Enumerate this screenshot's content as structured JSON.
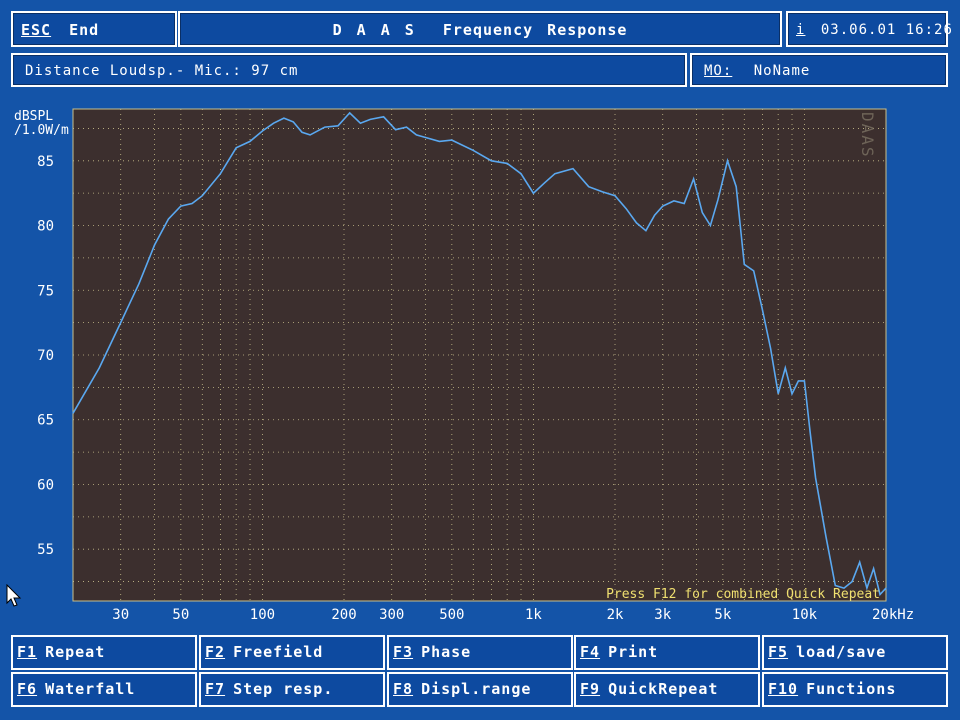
{
  "title_bar": {
    "esc_key": "ESC",
    "esc_label": "End",
    "title": "D A A S  Frequency Response",
    "info_key": "i",
    "datetime": "03.06.01 16:26"
  },
  "info_bar": {
    "distance_label": "Distance Loudsp.- Mic.: 97 cm",
    "mo_key": "MO:",
    "mo_value": "NoName"
  },
  "chart_header": {
    "ylabel_line1": "dBSPL",
    "ylabel_line2": "/1.0W/m",
    "watermark": "DAAS",
    "hint": "Press F12 for combined Quick Repeat",
    "x_unit": "20kHz"
  },
  "function_keys": [
    {
      "key": "F1",
      "label": "Repeat"
    },
    {
      "key": "F2",
      "label": "Freefield"
    },
    {
      "key": "F3",
      "label": "Phase"
    },
    {
      "key": "F4",
      "label": "Print"
    },
    {
      "key": "F5",
      "label": "load/save"
    },
    {
      "key": "F6",
      "label": "Waterfall"
    },
    {
      "key": "F7",
      "label": "Step resp."
    },
    {
      "key": "F8",
      "label": "Displ.range"
    },
    {
      "key": "F9",
      "label": "QuickRepeat"
    },
    {
      "key": "F10",
      "label": "Functions"
    }
  ],
  "colors": {
    "background": "#1454a8",
    "plot_bg": "#3c2f2e",
    "grid": "#c8bf8c",
    "curve": "#5aa8f0",
    "hint_text": "#f0e070"
  },
  "chart_data": {
    "type": "line",
    "xscale": "log",
    "xlim": [
      20,
      20000
    ],
    "ylim": [
      51,
      89
    ],
    "yticks": [
      55,
      60,
      65,
      70,
      75,
      80,
      85
    ],
    "xtick_labels": [
      {
        "v": 30,
        "t": "30"
      },
      {
        "v": 50,
        "t": "50"
      },
      {
        "v": 100,
        "t": "100"
      },
      {
        "v": 200,
        "t": "200"
      },
      {
        "v": 300,
        "t": "300"
      },
      {
        "v": 500,
        "t": "500"
      },
      {
        "v": 1000,
        "t": "1k"
      },
      {
        "v": 2000,
        "t": "2k"
      },
      {
        "v": 3000,
        "t": "3k"
      },
      {
        "v": 5000,
        "t": "5k"
      },
      {
        "v": 10000,
        "t": "10k"
      }
    ],
    "grid": true,
    "series": [
      {
        "x": [
          20,
          25,
          30,
          35,
          40,
          45,
          50,
          55,
          60,
          70,
          80,
          90,
          100,
          110,
          120,
          130,
          140,
          150,
          170,
          190,
          210,
          230,
          250,
          280,
          310,
          340,
          370,
          400,
          450,
          500,
          600,
          700,
          800,
          900,
          1000,
          1100,
          1200,
          1400,
          1600,
          1800,
          2000,
          2200,
          2400,
          2600,
          2800,
          3000,
          3300,
          3600,
          3900,
          4200,
          4500,
          4800,
          5200,
          5600,
          6000,
          6500,
          7000,
          7500,
          8000,
          8500,
          9000,
          9500,
          10000,
          10500,
          11000,
          12000,
          13000,
          14000,
          15000,
          16000,
          17000,
          18000,
          19000,
          20000
        ],
        "y": [
          65.5,
          69.0,
          72.5,
          75.5,
          78.5,
          80.5,
          81.5,
          81.7,
          82.3,
          84.0,
          86.0,
          86.5,
          87.3,
          87.9,
          88.3,
          88.0,
          87.2,
          87.0,
          87.6,
          87.7,
          88.7,
          87.9,
          88.2,
          88.4,
          87.4,
          87.6,
          87.0,
          86.8,
          86.5,
          86.6,
          85.8,
          85.0,
          84.8,
          84.0,
          82.5,
          83.3,
          84.0,
          84.4,
          83.0,
          82.6,
          82.3,
          81.3,
          80.2,
          79.6,
          80.8,
          81.5,
          81.9,
          81.7,
          83.6,
          81.0,
          80.0,
          82.0,
          85.0,
          83.0,
          77.0,
          76.5,
          73.5,
          70.5,
          67.0,
          69.0,
          67.0,
          68.0,
          68.0,
          64.0,
          60.5,
          56.0,
          52.2,
          52.0,
          52.5,
          54.0,
          52.0,
          53.5,
          51.5,
          52.0
        ]
      }
    ]
  }
}
